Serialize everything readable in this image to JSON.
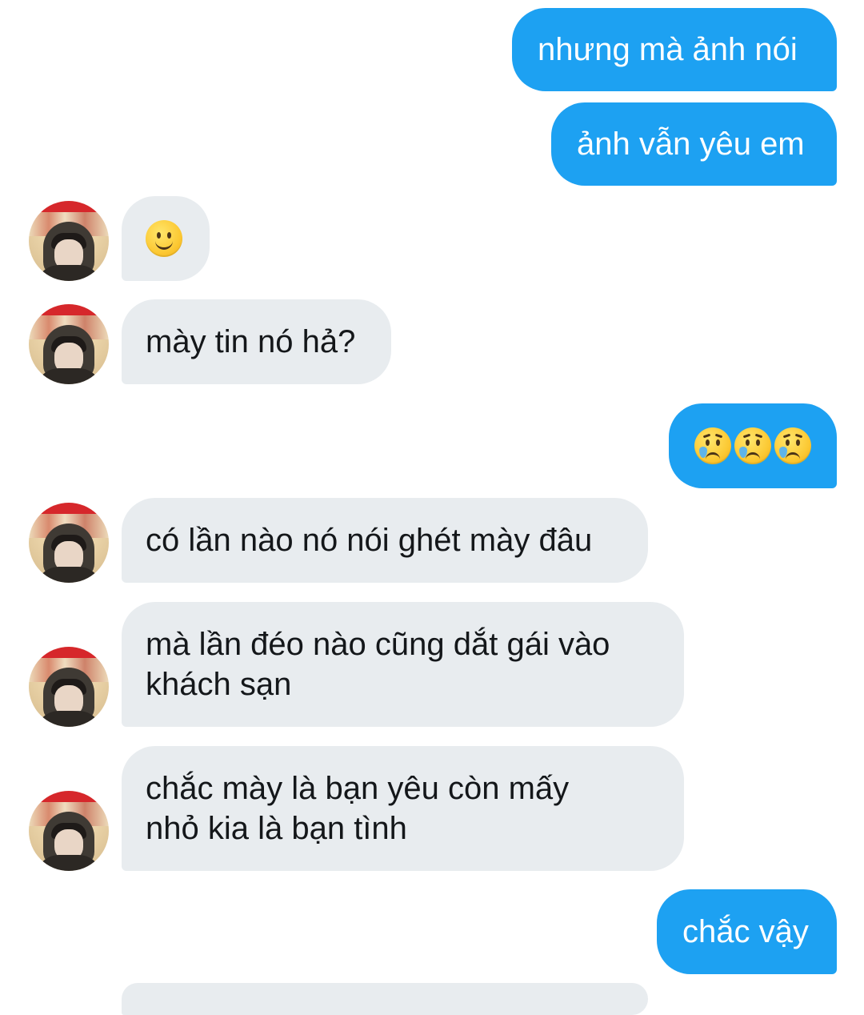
{
  "colors": {
    "outgoing_bubble": "#1da1f2",
    "incoming_bubble": "#e8ecef",
    "outgoing_text": "#ffffff",
    "incoming_text": "#14171a"
  },
  "messages": [
    {
      "id": "m1",
      "direction": "outgoing",
      "lines": [
        "nhưng mà ảnh nói"
      ]
    },
    {
      "id": "m2",
      "direction": "outgoing",
      "lines": [
        "ảnh vẫn yêu em"
      ]
    },
    {
      "id": "m3",
      "direction": "incoming",
      "emoji": [
        "slightly-smiling-face-icon"
      ]
    },
    {
      "id": "m4",
      "direction": "incoming",
      "lines": [
        "mày tin nó hả?"
      ]
    },
    {
      "id": "m5",
      "direction": "outgoing",
      "emoji": [
        "crying-face-icon",
        "crying-face-icon",
        "crying-face-icon"
      ]
    },
    {
      "id": "m6",
      "direction": "incoming",
      "lines": [
        "có lần nào nó nói ghét mày đâu"
      ]
    },
    {
      "id": "m7",
      "direction": "incoming",
      "lines": [
        "mà lần đéo nào cũng dắt gái vào",
        "khách sạn"
      ]
    },
    {
      "id": "m8",
      "direction": "incoming",
      "lines": [
        "chắc mày là bạn yêu còn mấy",
        "nhỏ kia là bạn tình"
      ]
    },
    {
      "id": "m9",
      "direction": "outgoing",
      "lines": [
        "chắc vậy"
      ]
    }
  ]
}
